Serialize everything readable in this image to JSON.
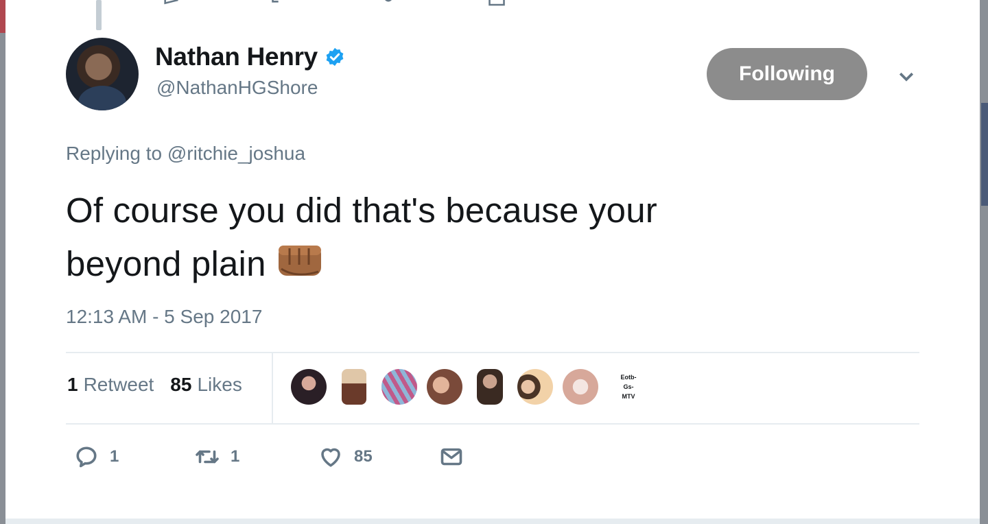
{
  "author": {
    "name": "Nathan Henry",
    "handle": "@NathanHGShore",
    "verified": true
  },
  "follow_button_label": "Following",
  "reply": {
    "prefix": "Replying to",
    "mention": "@ritchie_joshua"
  },
  "tweet": {
    "line1": "Of course you did that's because your",
    "line2": "beyond plain",
    "emoji": "oncoming-fist-medium-dark-skin-icon"
  },
  "timestamp": "12:13 AM - 5 Sep 2017",
  "stats": {
    "retweet_count": "1",
    "retweet_label": "Retweet",
    "like_count": "85",
    "like_label": "Likes"
  },
  "likers": {
    "text_avatar_lines": [
      "Eotb-",
      "Gs-",
      "MTV"
    ]
  },
  "actions": {
    "reply_count": "1",
    "retweet_count": "1",
    "like_count": "85"
  },
  "colors": {
    "text": "#14171a",
    "secondary": "#657786",
    "following_button": "#8c8c8c",
    "verified": "#1da1f2",
    "divider": "#e6ecf0"
  }
}
